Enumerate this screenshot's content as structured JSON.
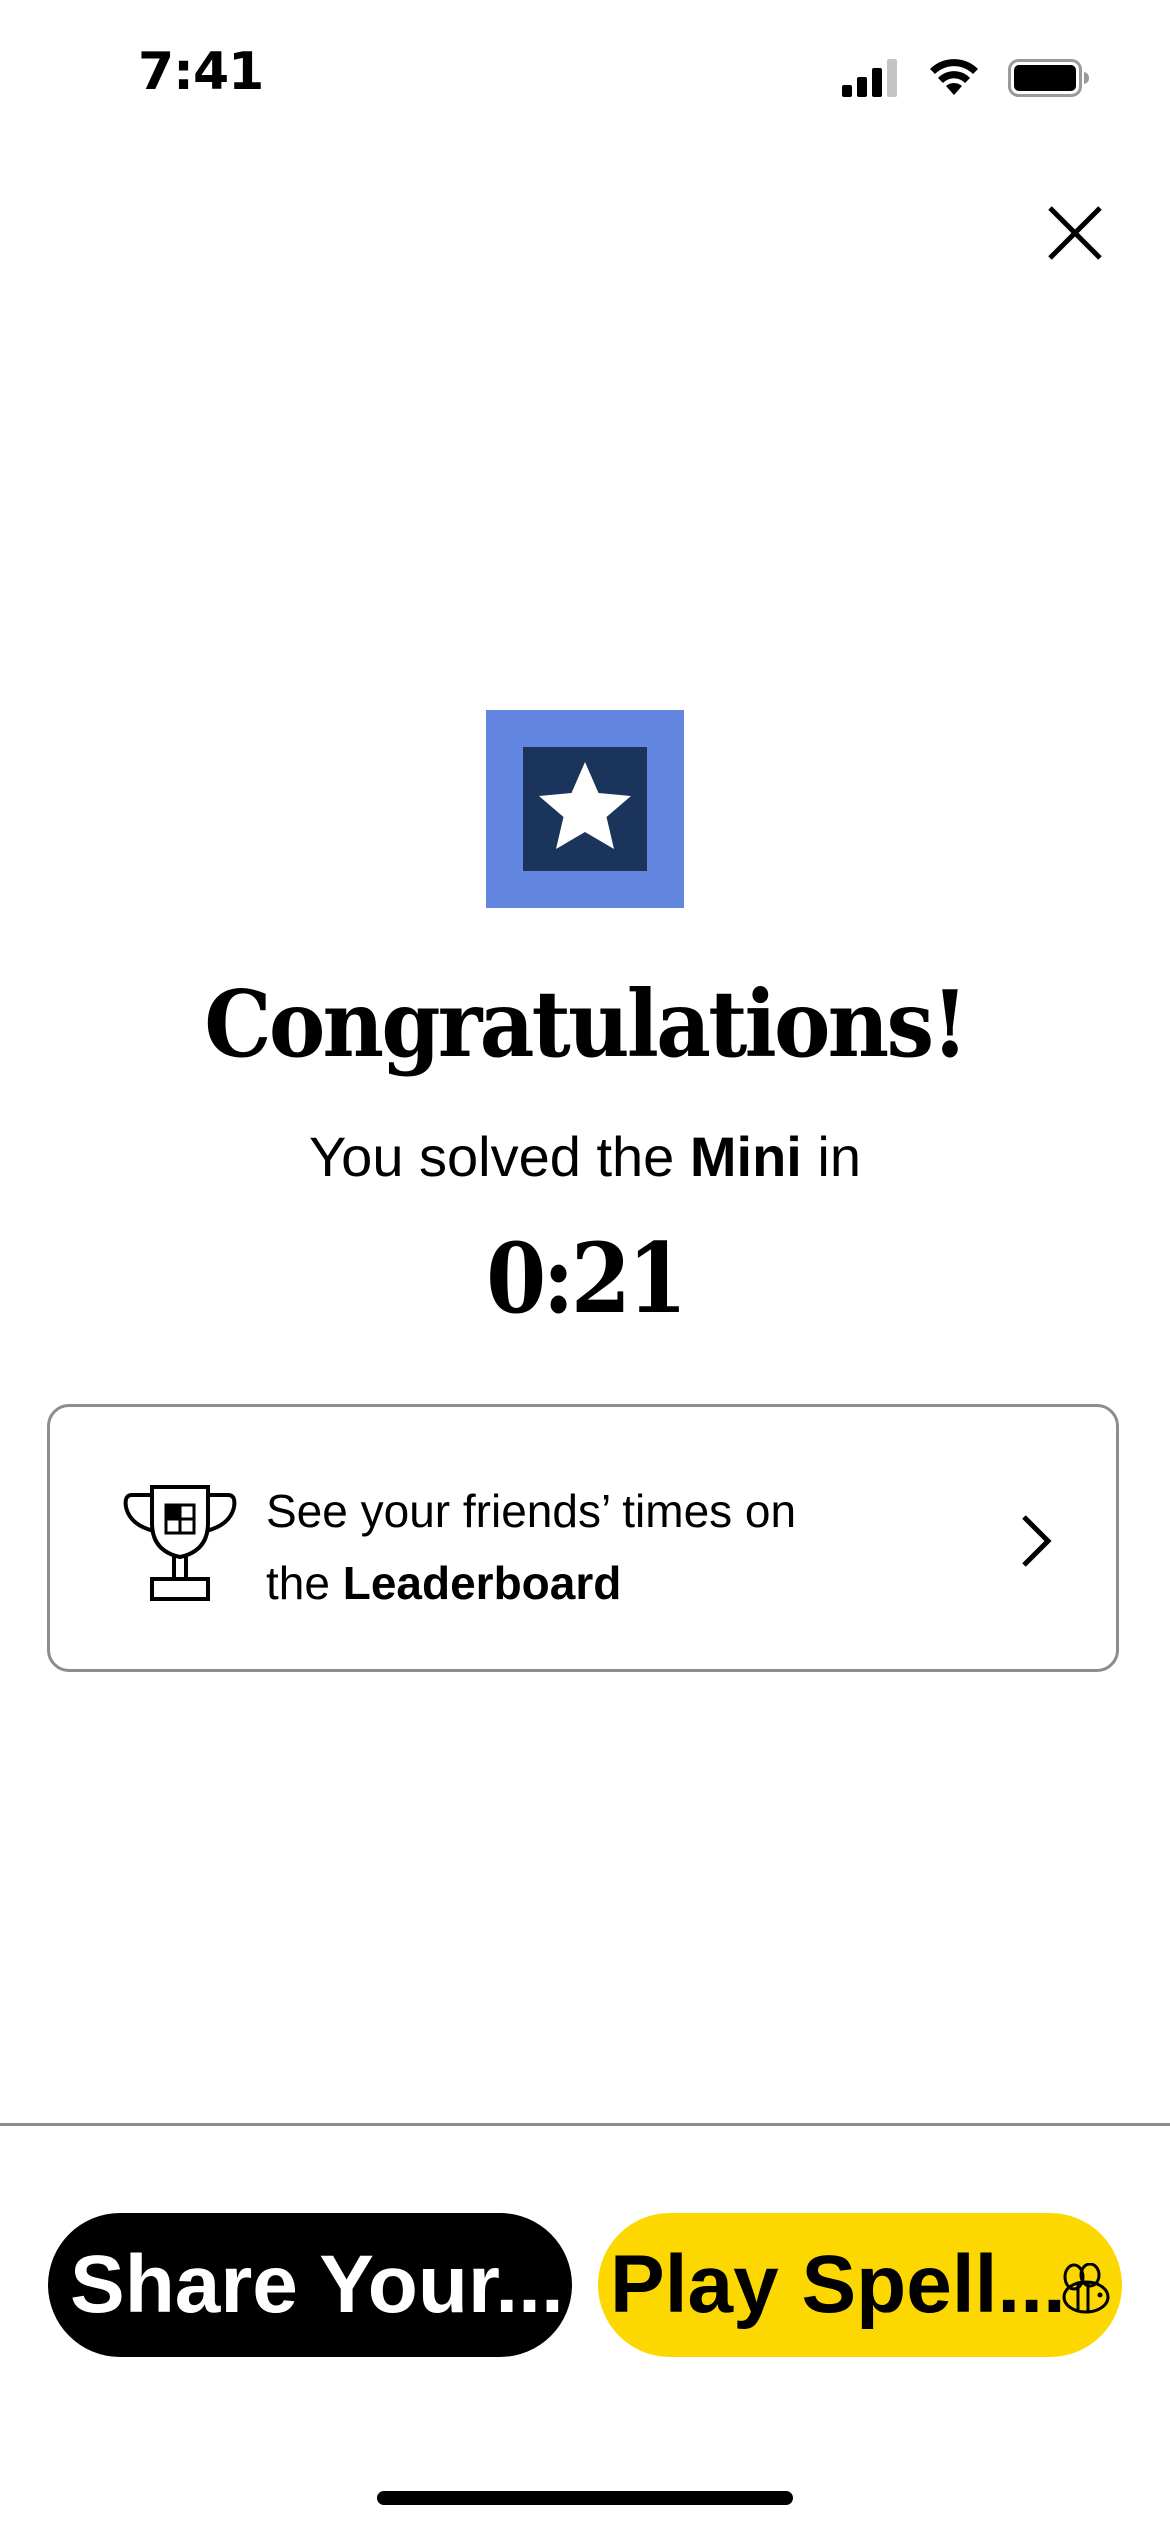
{
  "status_bar": {
    "time": "7:41"
  },
  "icons": {
    "signal": "cellular-signal-icon",
    "wifi": "wifi-icon",
    "battery": "battery-icon",
    "close": "close-icon",
    "badge_star": "star-icon",
    "trophy": "trophy-icon",
    "chevron": "chevron-right-icon",
    "bee": "bee-icon"
  },
  "colors": {
    "badge_outer": "#6387e1",
    "badge_inner": "#1b345c",
    "share_button": "#000000",
    "spell_button": "#fcd800"
  },
  "main": {
    "title": "Congratulations!",
    "subtitle_prefix": "You solved the ",
    "subtitle_puzzle": "Mini",
    "subtitle_suffix": " in",
    "solve_time": "0:21"
  },
  "leaderboard": {
    "line1": "See your friends’ times on",
    "line2_prefix": "the ",
    "line2_link": "Leaderboard"
  },
  "actions": {
    "share_label": "Share Your...",
    "spell_label": "Play Spell..."
  }
}
